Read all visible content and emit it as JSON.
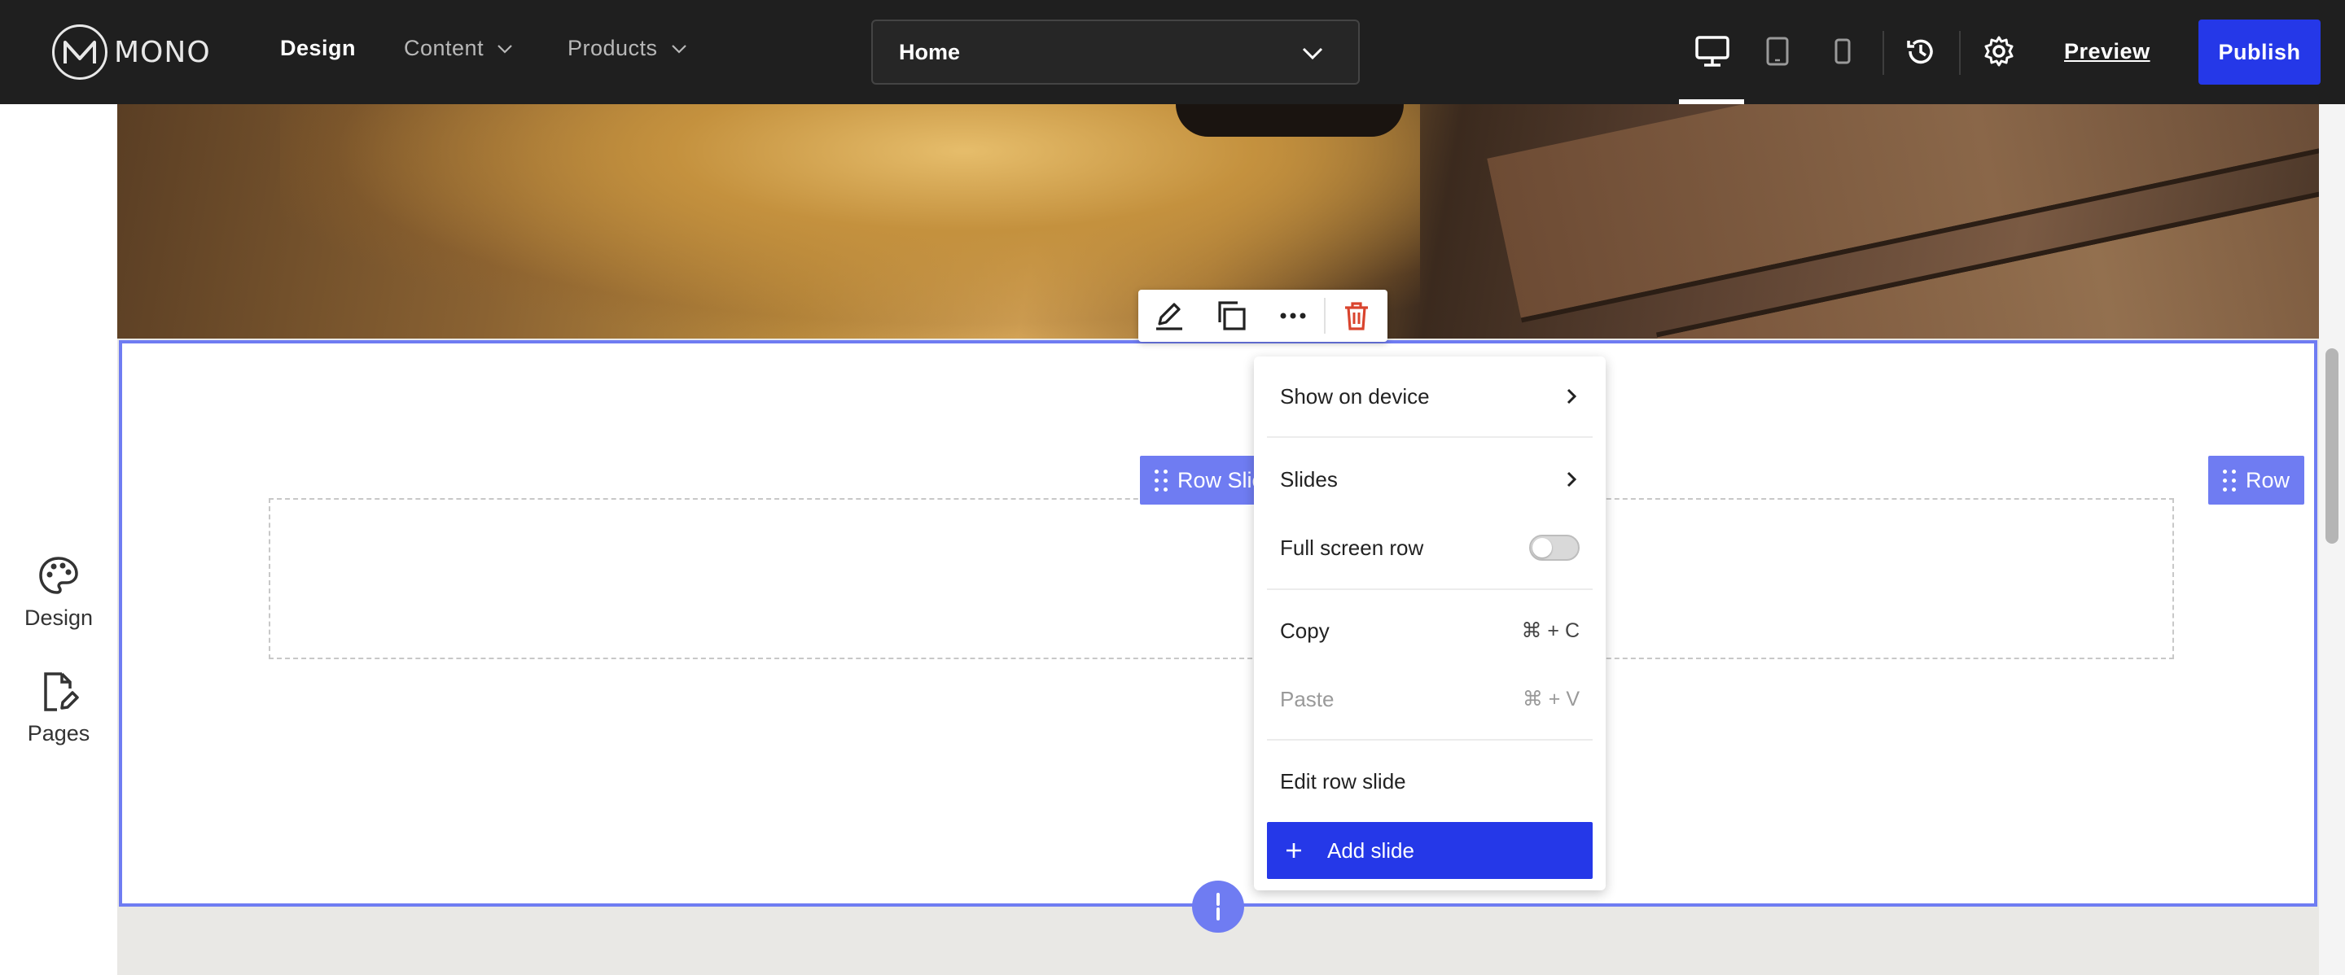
{
  "app": {
    "logo_text": "MONO"
  },
  "nav": {
    "design": "Design",
    "content": "Content",
    "products": "Products"
  },
  "page_selector": {
    "value": "Home"
  },
  "header_actions": {
    "preview": "Preview",
    "publish": "Publish"
  },
  "sidebar": {
    "items": [
      {
        "label": "Design",
        "icon": "palette-icon"
      },
      {
        "label": "Pages",
        "icon": "page-edit-icon"
      }
    ]
  },
  "canvas": {
    "row_tag_left": "Row Slic",
    "row_tag_right": "Row"
  },
  "context_menu": {
    "show_on_device": "Show on device",
    "slides": "Slides",
    "full_screen_row": "Full screen row",
    "full_screen_row_enabled": false,
    "copy": "Copy",
    "copy_shortcut": "⌘ + C",
    "paste": "Paste",
    "paste_shortcut": "⌘ + V",
    "edit_row_slide": "Edit row slide",
    "add_slide": "Add slide"
  },
  "colors": {
    "accent": "#2538e8",
    "selection": "#6f7cf2",
    "topbar": "#1f1f1f",
    "delete": "#d9442e"
  }
}
